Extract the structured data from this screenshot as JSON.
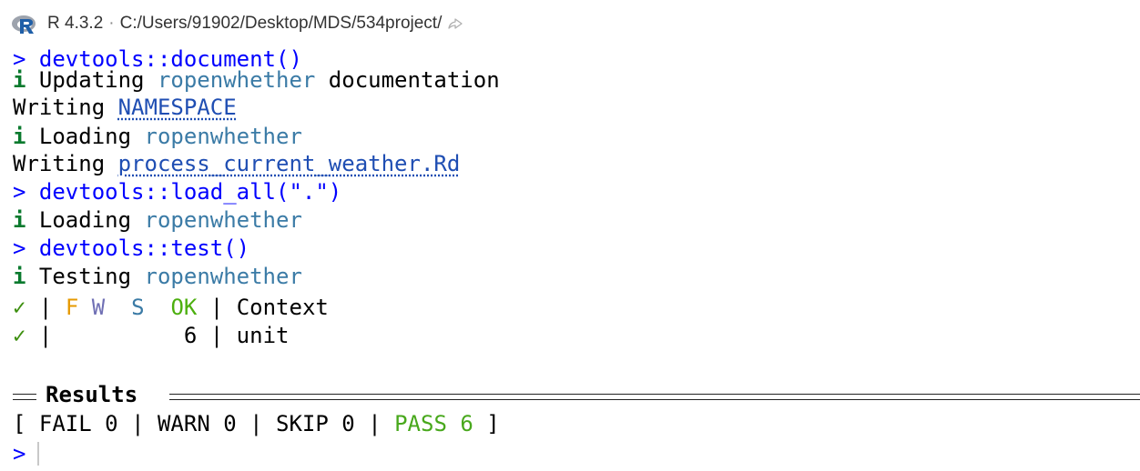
{
  "header": {
    "version": "R 4.3.2",
    "separator": "·",
    "path": "C:/Users/91902/Desktop/MDS/534project/",
    "logo_icon": "r-logo-icon",
    "arrow_icon": "go-to-directory-icon"
  },
  "console": {
    "prompt": ">",
    "info_glyph": "i",
    "check_glyph": "✓",
    "pipe": "|",
    "lines": {
      "l1_cmd": "devtools::document()",
      "l2_text1": "Updating",
      "l2_pkg": "ropenwhether",
      "l2_text2": "documentation",
      "l3_text": "Writing",
      "l3_link": "NAMESPACE",
      "l4_text": "Loading",
      "l4_pkg": "ropenwhether",
      "l5_text": "Writing",
      "l5_link": "process_current_weather.Rd",
      "l6_cmd": "devtools::load_all(\".\")",
      "l7_text": "Loading",
      "l7_pkg": "ropenwhether",
      "l8_cmd": "devtools::test()",
      "l9_text": "Testing",
      "l9_pkg": "ropenwhether",
      "l10_f": "F",
      "l10_w": "W",
      "l10_s": "S",
      "l10_ok": "OK",
      "l10_context": "Context",
      "l11_count": "6",
      "l11_context": "unit",
      "results_label": "Results",
      "summary_open": "[",
      "summary_fail": "FAIL 0",
      "summary_warn": "WARN 0",
      "summary_skip": "SKIP 0",
      "summary_pass": "PASS 6",
      "summary_close": "]"
    }
  },
  "colors": {
    "command": "#0000ff",
    "info": "#0a7a2e",
    "package": "#3b7ba6",
    "link": "#1f4eb3",
    "check": "#3d8f0f",
    "fail": "#e69a00",
    "warn": "#6f6fb4",
    "ok": "#4caf0e",
    "pass": "#48a81c"
  }
}
